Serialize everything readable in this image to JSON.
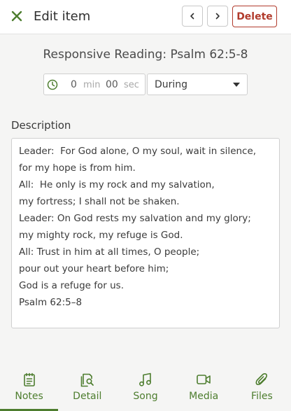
{
  "header": {
    "title": "Edit item",
    "delete_label": "Delete",
    "icons": {
      "close": "close-icon",
      "prev": "chevron-left-icon",
      "next": "chevron-right-icon"
    }
  },
  "item": {
    "title": "Responsive Reading: Psalm 62:5-8"
  },
  "duration": {
    "minutes": "0",
    "minutes_unit": "min",
    "seconds": "00",
    "seconds_unit": "sec"
  },
  "timing": {
    "selected": "During"
  },
  "description": {
    "label": "Description",
    "lines": [
      "Leader:  For God alone, O my soul, wait in silence,",
      "for my hope is from him.",
      "All:  He only is my rock and my salvation,",
      "my fortress; I shall not be shaken.",
      "Leader: On God rests my salvation and my glory;",
      "my mighty rock, my refuge is God.",
      "All: Trust in him at all times, O people;",
      "pour out your heart before him;",
      "God is a refuge for us.",
      "Psalm 62:5–8"
    ]
  },
  "tabs": [
    {
      "label": "Notes",
      "icon": "notes-icon",
      "active": true
    },
    {
      "label": "Detail",
      "icon": "detail-icon",
      "active": false
    },
    {
      "label": "Song",
      "icon": "music-note-icon",
      "active": false
    },
    {
      "label": "Media",
      "icon": "video-icon",
      "active": false
    },
    {
      "label": "Files",
      "icon": "paperclip-icon",
      "active": false
    }
  ],
  "colors": {
    "accent": "#4d7d2e",
    "danger": "#b13b2c",
    "background": "#f5f5f4"
  }
}
